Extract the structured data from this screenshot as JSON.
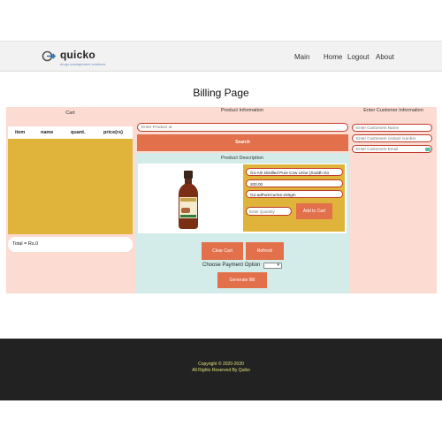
{
  "header": {
    "brand": "quicko",
    "tagline": "drugs management solutions",
    "nav": [
      "Main",
      "Home",
      "Logout",
      "About"
    ]
  },
  "page_title": "Billing Page",
  "cart": {
    "heading": "Cart",
    "columns": [
      "item",
      "name",
      "quant.",
      "price(rs)"
    ],
    "rows": [],
    "total": "Total = Rs.0"
  },
  "product": {
    "heading": "Product Information",
    "id_placeholder": "Enter Product id",
    "search_label": "Search",
    "description_heading": "Product Description",
    "name_value": "Go-Ark Distilled Pure Cow Urine (Suddh Go",
    "price_value": "200.00",
    "code_value": "Go-adPureCurine-220gm",
    "quantity_placeholder": "Enter Quantity",
    "add_label": "Add to Cart"
  },
  "actions": {
    "clear_label": "Clear Cart",
    "refresh_label": "Refresh",
    "payment_label": "Choose Payment Option",
    "payment_value": "",
    "generate_label": "Generate Bill"
  },
  "customer": {
    "heading": "Enter Customer Information",
    "name_placeholder": "Enter Customers Name",
    "contact_placeholder": "Enter Customers contact number",
    "email_placeholder": "Enter Customers Email"
  },
  "footer": {
    "copyright": "Copyright © 2020-2020",
    "rights": "All Rights Reserved By Quiko"
  },
  "colors": {
    "accent": "#e2704b",
    "panel_pink": "#fbdbd2",
    "panel_teal": "#d3ecea",
    "cart_yellow": "#e0b33a",
    "footer_bg": "#222222"
  }
}
